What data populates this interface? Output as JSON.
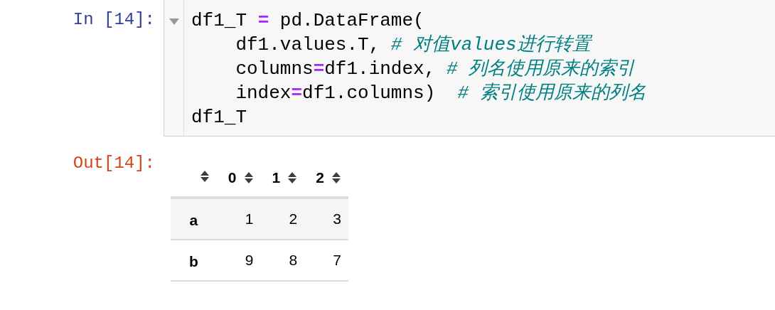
{
  "input_cell": {
    "prompt": "In [14]:",
    "collapsed": false,
    "lines": [
      [
        {
          "kind": "plain",
          "text": "df1_T "
        },
        {
          "kind": "operator",
          "text": "="
        },
        {
          "kind": "plain",
          "text": " pd.DataFrame("
        }
      ],
      [
        {
          "kind": "plain",
          "text": "    df1.values.T, "
        },
        {
          "kind": "comment",
          "text": "# 对值values进行转置"
        }
      ],
      [
        {
          "kind": "plain",
          "text": "    columns"
        },
        {
          "kind": "operator",
          "text": "="
        },
        {
          "kind": "plain",
          "text": "df1.index, "
        },
        {
          "kind": "comment",
          "text": "# 列名使用原来的索引"
        }
      ],
      [
        {
          "kind": "plain",
          "text": "    index"
        },
        {
          "kind": "operator",
          "text": "="
        },
        {
          "kind": "plain",
          "text": "df1.columns)  "
        },
        {
          "kind": "comment",
          "text": "# 索引使用原来的列名"
        }
      ],
      [
        {
          "kind": "plain",
          "text": "df1_T"
        }
      ]
    ]
  },
  "output_cell": {
    "prompt": "Out[14]:",
    "table": {
      "columns": [
        "0",
        "1",
        "2"
      ],
      "rows": [
        {
          "index": "a",
          "cells": [
            "1",
            "2",
            "3"
          ]
        },
        {
          "index": "b",
          "cells": [
            "9",
            "8",
            "7"
          ]
        }
      ]
    }
  }
}
